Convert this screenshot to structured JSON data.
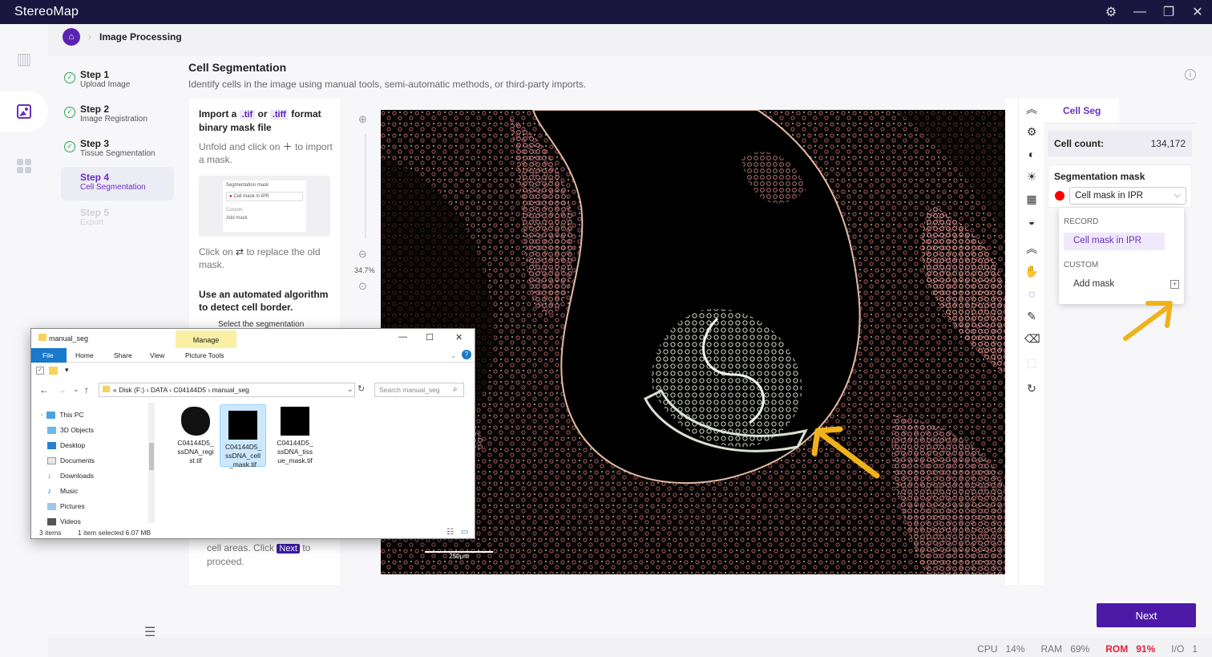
{
  "window": {
    "app_title": "StereoMap"
  },
  "breadcrumb": {
    "page": "Image Processing"
  },
  "steps": [
    {
      "title": "Step 1",
      "subtitle": "Upload Image"
    },
    {
      "title": "Step 2",
      "subtitle": "Image Registration"
    },
    {
      "title": "Step 3",
      "subtitle": "Tissue Segmentation"
    },
    {
      "title": "Step 4",
      "subtitle": "Cell Segmentation"
    },
    {
      "title": "Step 5",
      "subtitle": "Export"
    }
  ],
  "header": {
    "title": "Cell Segmentation",
    "subtitle": "Identify cells in the image using manual tools, semi-automatic methods, or third-party imports."
  },
  "instructions": {
    "import_1": "Import a",
    "ext_tif": ".tif",
    "or": "or",
    "ext_tiff": ".tiff",
    "import_2": "format binary mask file",
    "unfold_1": "Unfold and click on",
    "unfold_2": "to import a mask.",
    "replace_1": "Click on",
    "replace_2": "to replace the old mask.",
    "algo": "Use an automated algorithm to detect cell border.",
    "select": "Select the segmentation",
    "tail_1": "cell areas. Click",
    "tail_next": "Next",
    "tail_2": "to proceed.",
    "thumb_title": "Segmentation mask",
    "thumb_select": "Cell mask in IPR",
    "thumb_custom": "Custom",
    "thumb_add": "Add mask"
  },
  "zoom": {
    "level": "34.7%"
  },
  "scale_bar": "250μm",
  "right_panel": {
    "tab": "Cell Seg",
    "cell_count_label": "Cell count:",
    "cell_count_value": "134,172",
    "seg_mask_label": "Segmentation mask",
    "selected_mask": "Cell mask in IPR",
    "mask_color": "#ff0000"
  },
  "dropdown": {
    "group_record": "RECORD",
    "item_record": "Cell mask in IPR",
    "group_custom": "CUSTOM",
    "item_add": "Add mask"
  },
  "actions": {
    "next": "Next"
  },
  "status": {
    "cpu_label": "CPU",
    "cpu_value": "14%",
    "ram_label": "RAM",
    "ram_value": "69%",
    "rom_label": "ROM",
    "rom_value": "91%",
    "io_label": "I/O",
    "io_value": "1"
  },
  "explorer": {
    "title": "manual_seg",
    "manage": "Manage",
    "tabs": [
      "File",
      "Home",
      "Share",
      "View",
      "Picture Tools"
    ],
    "address": [
      "«",
      "Disk (F:)",
      "›",
      "DATA",
      "›",
      "C04144D5",
      "›",
      "manual_seg"
    ],
    "search_placeholder": "Search manual_seg",
    "tree": [
      "This PC",
      "3D Objects",
      "Desktop",
      "Documents",
      "Downloads",
      "Music",
      "Pictures",
      "Videos"
    ],
    "files": [
      {
        "name": "C04144D5_ ssDNA_regi st.tif"
      },
      {
        "name": "C04144D5_ ssDNA_cell _mask.tif"
      },
      {
        "name": "C04144D5_ ssDNA_tiss ue_mask.tif"
      }
    ],
    "status_items": "3 items",
    "status_selected": "1 item selected  6.07 MB"
  },
  "colors": {
    "accent": "#6b2fc0",
    "next_button": "#4d1aa8",
    "titlebar": "#1a1640",
    "arrow": "#f0b21a"
  }
}
